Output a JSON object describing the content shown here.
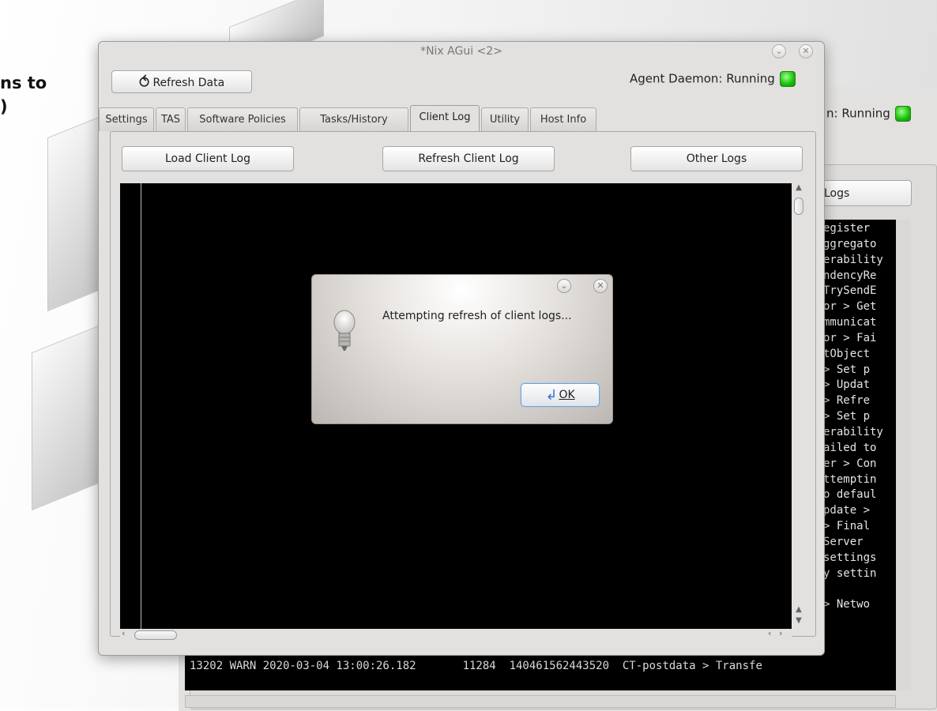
{
  "background": {
    "text_lines": [
      "ns to",
      ")"
    ],
    "agent_status": "n: Running",
    "logs_button": "Logs",
    "log_lines": [
      "egister",
      "ggregato",
      "erability",
      "ndencyRe",
      "TrySendE",
      "or > Get",
      "mmunicat",
      "or > Fai",
      "tObject ",
      "> Set p",
      "> Updat",
      "> Refre",
      "> Set p",
      "erability",
      "ailed to",
      "er > Con",
      "ttemptin",
      "o defaul",
      "pdate > ",
      "> Final",
      "Server",
      "settings",
      "y settin",
      "",
      "> Netwo"
    ],
    "bottom_line": "13202 WARN 2020-03-04 13:00:26.182       11284  140461562443520  CT-postdata > Transfe"
  },
  "window": {
    "title": "*Nix AGui <2>",
    "refresh_label": "Refresh Data",
    "agent_status": "Agent Daemon: Running",
    "led_color": "#16c10b"
  },
  "tabs": [
    {
      "label": "Settings"
    },
    {
      "label": "TAS"
    },
    {
      "label": "Software Policies"
    },
    {
      "label": "Tasks/History"
    },
    {
      "label": "Client Log",
      "active": true
    },
    {
      "label": "Utility"
    },
    {
      "label": "Host Info"
    }
  ],
  "client_log": {
    "load_label": "Load Client Log",
    "refresh_label": "Refresh Client Log",
    "other_label": "Other Logs"
  },
  "dialog": {
    "message": "Attempting refresh of client logs...",
    "ok_label": "OK",
    "icon": "lightbulb-icon"
  }
}
